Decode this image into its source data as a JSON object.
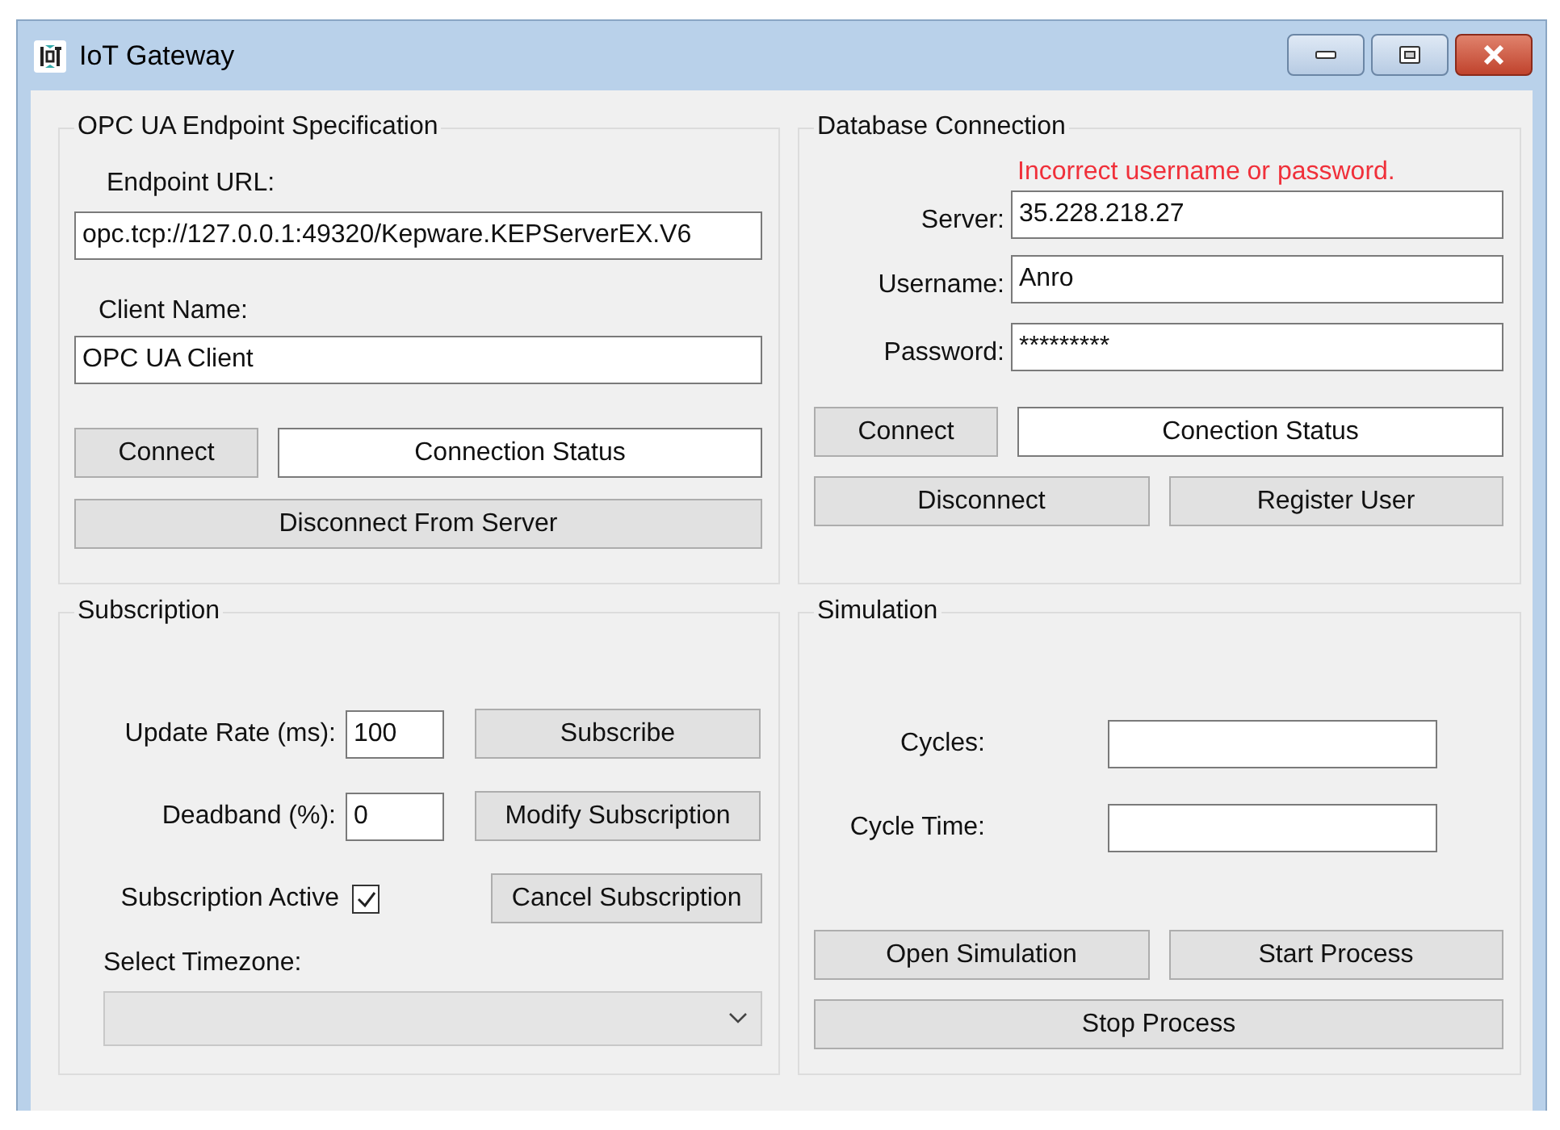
{
  "window": {
    "title": "IoT Gateway"
  },
  "opc_endpoint": {
    "title": "OPC UA Endpoint Specification",
    "endpoint_url_label": "Endpoint URL:",
    "endpoint_url": "opc.tcp://127.0.0.1:49320/Kepware.KEPServerEX.V6",
    "client_name_label": "Client Name:",
    "client_name": "OPC UA Client",
    "connect_button": "Connect",
    "connection_status": "Connection Status",
    "disconnect_button": "Disconnect From Server"
  },
  "database": {
    "title": "Database Connection",
    "error": "Incorrect username or password.",
    "fields": [
      {
        "label": "Server:",
        "value": "35.228.218.27"
      },
      {
        "label": "Username:",
        "value": "Anro"
      },
      {
        "label": "Password:",
        "value": "*********"
      }
    ],
    "connect_button": "Connect",
    "connection_status": "Conection Status",
    "disconnect_button": "Disconnect",
    "register_button": "Register User"
  },
  "subscription": {
    "title": "Subscription",
    "update_rate_label": "Update Rate (ms):",
    "update_rate": "100",
    "deadband_label": "Deadband (%):",
    "deadband": "0",
    "subscribe_button": "Subscribe",
    "modify_button": "Modify Subscription",
    "cancel_button": "Cancel Subscription",
    "active_label": "Subscription Active",
    "active_checked": true,
    "timezone_label": "Select Timezone:"
  },
  "simulation": {
    "title": "Simulation",
    "cycles_label": "Cycles:",
    "cycle_time_label": "Cycle Time:",
    "open_button": "Open Simulation",
    "start_button": "Start Process",
    "stop_button": "Stop Process"
  }
}
